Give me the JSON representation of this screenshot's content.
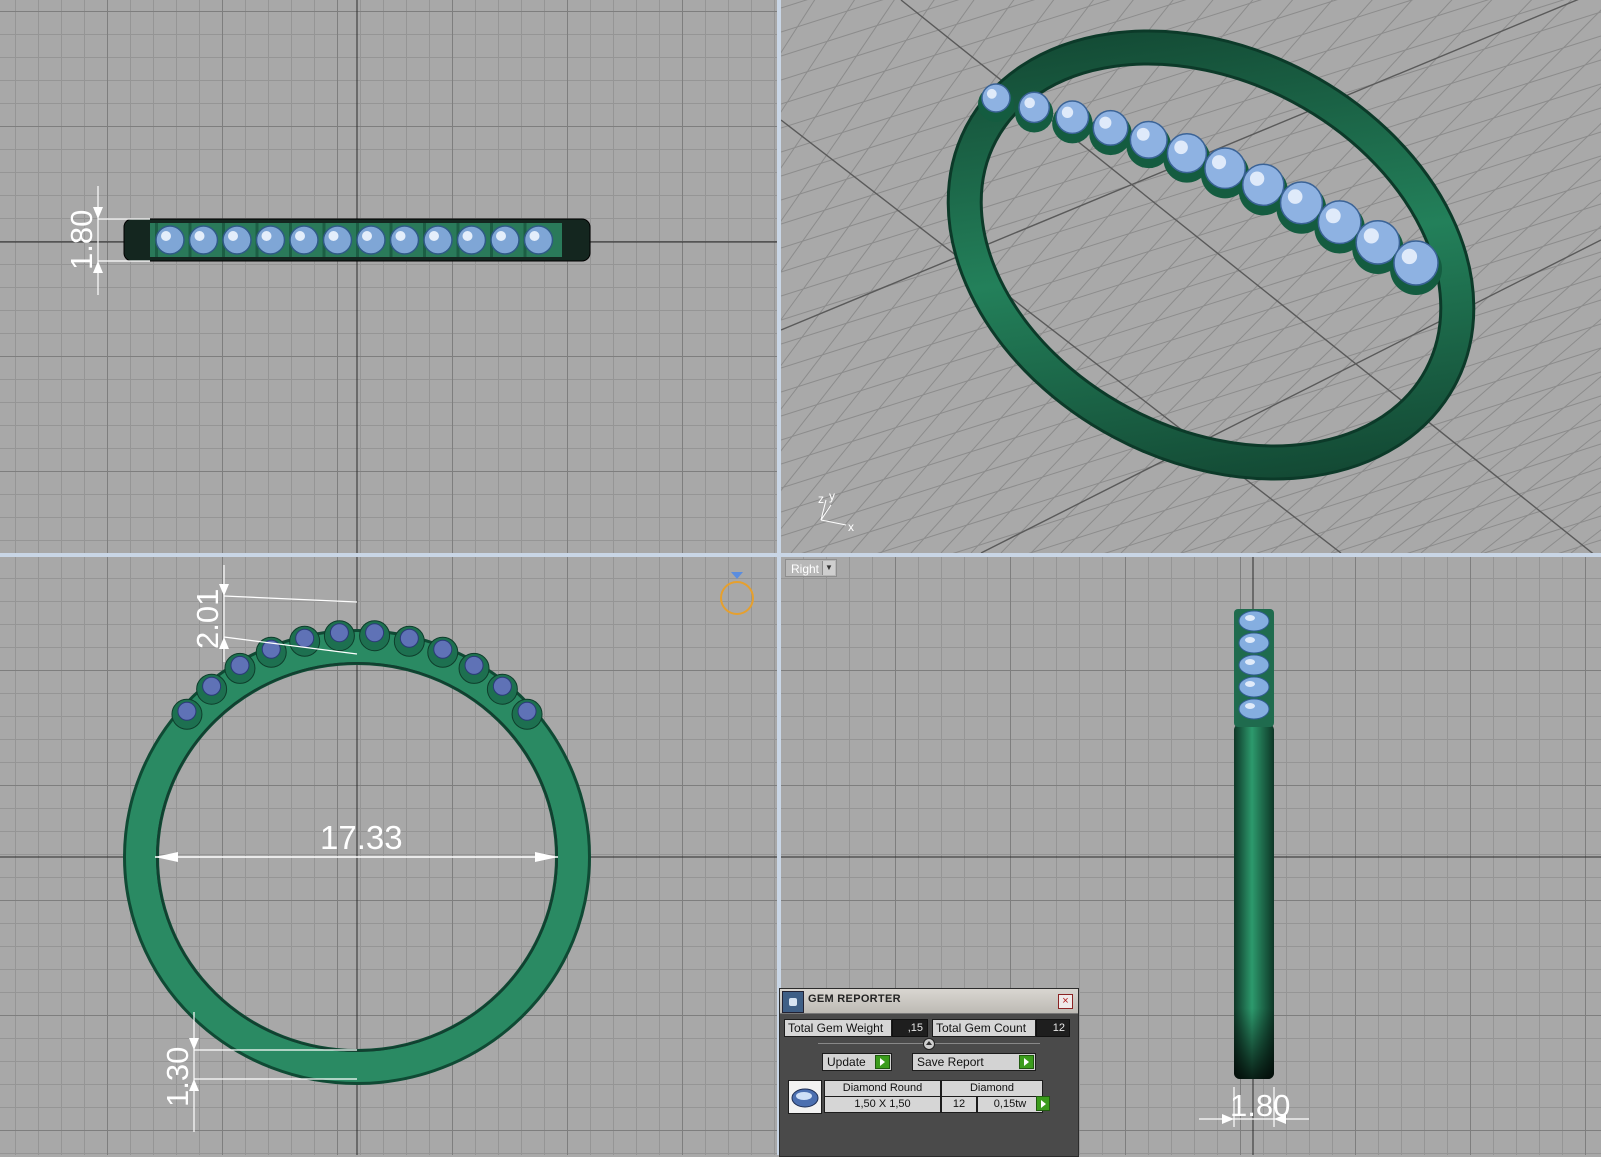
{
  "viewports": {
    "top_left": {
      "dimension_height": "1.80"
    },
    "bottom_left": {
      "dimension_top": "2.01",
      "dimension_inner": "17.33",
      "dimension_bottom": "1.30"
    },
    "bottom_right": {
      "label": "Right",
      "dimension_width": "1.80"
    },
    "top_right": {
      "axis_z": "z",
      "axis_y": "y",
      "axis_x": "x"
    }
  },
  "colors": {
    "ring_green": "#1f7a52",
    "gem_blue": "#8fb6e8",
    "grid_bg": "#a8a8a8"
  },
  "gem_reporter": {
    "title": "GEM REPORTER",
    "total_gem_weight_label": "Total Gem Weight",
    "total_gem_weight_value": ",15",
    "total_gem_count_label": "Total Gem Count",
    "total_gem_count_value": "12",
    "update_label": "Update",
    "save_report_label": "Save Report",
    "gems": [
      {
        "shape": "Diamond Round",
        "size": "1,50 X 1,50",
        "material": "Diamond",
        "count": "12",
        "weight": "0,15tw"
      }
    ]
  }
}
